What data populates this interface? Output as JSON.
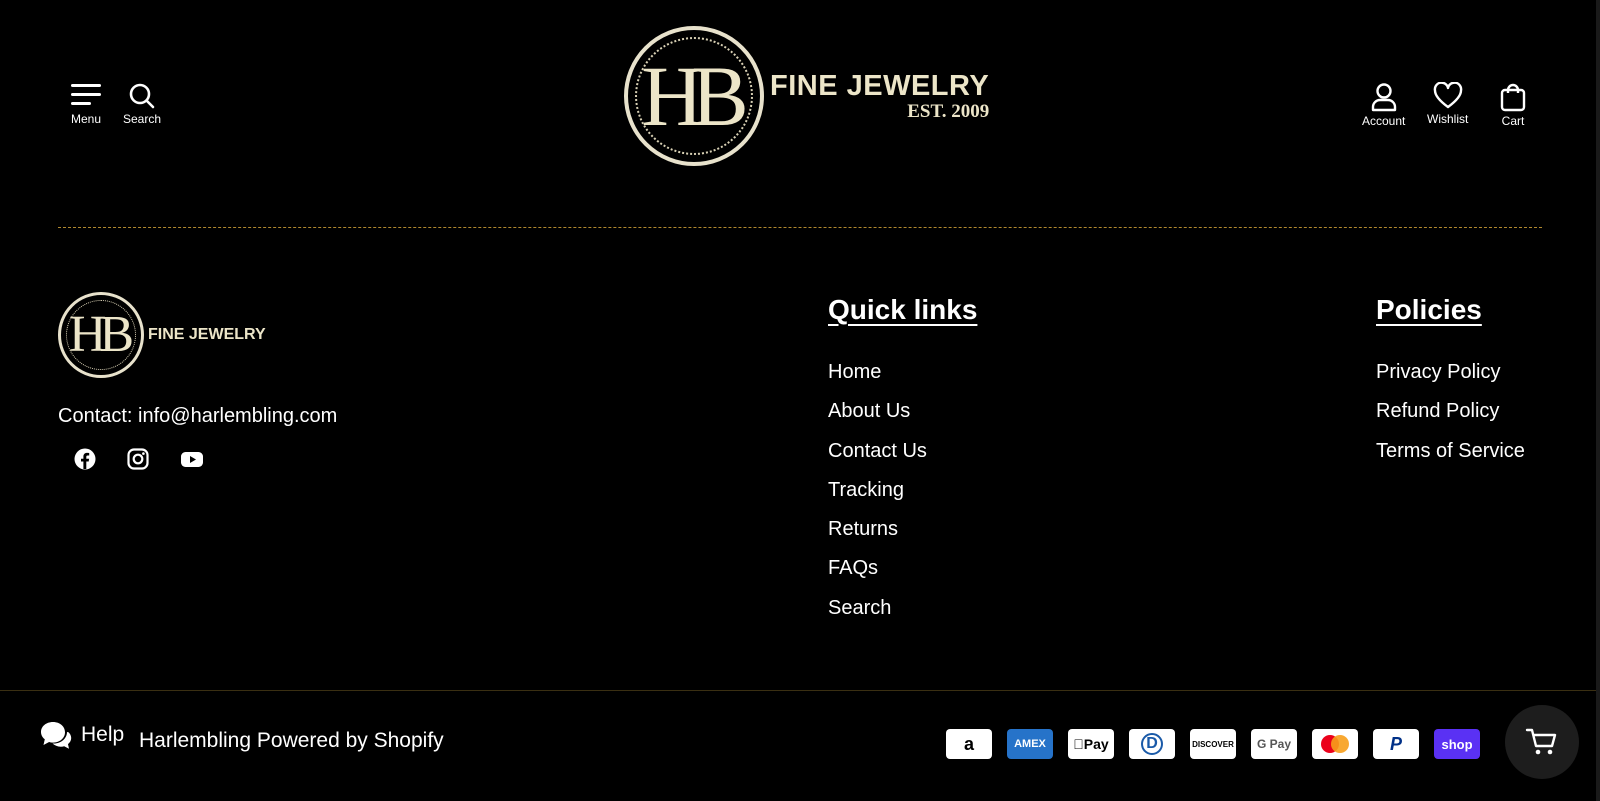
{
  "header": {
    "menu_label": "Menu",
    "search_label": "Search",
    "account_label": "Account",
    "wishlist_label": "Wishlist",
    "cart_label": "Cart",
    "logo_monogram": "HB",
    "logo_title": "FINE JEWELRY",
    "logo_est": "EST. 2009"
  },
  "footer": {
    "logo_monogram": "HB",
    "logo_title": "FINE JEWELRY",
    "contact": "Contact: info@harlembling.com",
    "socials": [
      "facebook-icon",
      "instagram-icon",
      "youtube-icon"
    ],
    "quick_links": {
      "title": "Quick links",
      "items": [
        "Home",
        "About Us",
        "Contact Us",
        "Tracking",
        "Returns",
        "FAQs",
        "Search"
      ]
    },
    "policies": {
      "title": "Policies",
      "items": [
        "Privacy Policy",
        "Refund Policy",
        "Terms of Service"
      ]
    },
    "help_label": "Help",
    "powered": "Harlembling Powered by Shopify",
    "payments": [
      "a",
      "AMEX",
      "Pay",
      "D",
      "DISCOVER",
      "G Pay",
      "",
      "P",
      "shop"
    ]
  },
  "colors": {
    "background": "#000000",
    "gold": "#ece5c8",
    "divider": "#b0882e"
  }
}
